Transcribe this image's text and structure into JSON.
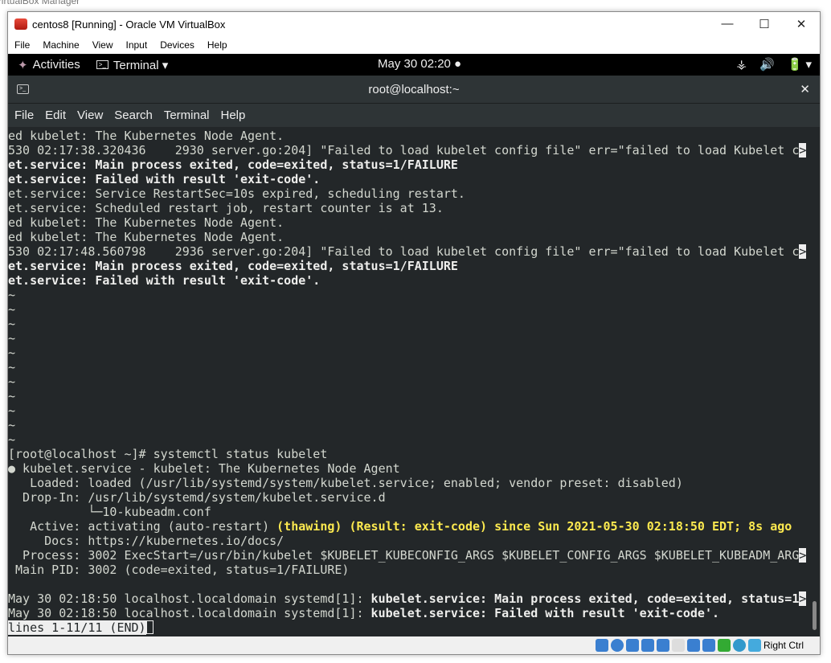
{
  "background": {
    "title": "VirtualBox Manager"
  },
  "window": {
    "title": "centos8 [Running] - Oracle VM VirtualBox",
    "controls": [
      "—",
      "☐",
      "✕"
    ]
  },
  "vbox_menu": [
    "File",
    "Machine",
    "View",
    "Input",
    "Devices",
    "Help"
  ],
  "gnome": {
    "activities": "Activities",
    "app": "Terminal ▾",
    "clock": "May 30  02:20 ●",
    "tray": [
      "⚶",
      "🔊",
      "🔋 ▾"
    ]
  },
  "terminal": {
    "title": "root@localhost:~",
    "close": "✕",
    "menu": [
      "File",
      "Edit",
      "View",
      "Search",
      "Terminal",
      "Help"
    ],
    "lines": [
      [
        [
          "n",
          "ed kubelet: The Kubernetes Node Agent."
        ]
      ],
      [
        [
          "n",
          "530 02:17:38.320436    2930 server.go:204] \"Failed to load kubelet config file\" err=\"failed to load Kubelet c"
        ],
        [
          "m",
          ">"
        ]
      ],
      [
        [
          "b",
          "et.service: Main process exited, code=exited, status=1/FAILURE"
        ]
      ],
      [
        [
          "b",
          "et.service: Failed with result 'exit-code'."
        ]
      ],
      [
        [
          "n",
          "et.service: Service RestartSec=10s expired, scheduling restart."
        ]
      ],
      [
        [
          "n",
          "et.service: Scheduled restart job, restart counter is at 13."
        ]
      ],
      [
        [
          "n",
          "ed kubelet: The Kubernetes Node Agent."
        ]
      ],
      [
        [
          "n",
          "ed kubelet: The Kubernetes Node Agent."
        ]
      ],
      [
        [
          "n",
          "530 02:17:48.560798    2936 server.go:204] \"Failed to load kubelet config file\" err=\"failed to load Kubelet c"
        ],
        [
          "m",
          ">"
        ]
      ],
      [
        [
          "b",
          "et.service: Main process exited, code=exited, status=1/FAILURE"
        ]
      ],
      [
        [
          "b",
          "et.service: Failed with result 'exit-code'."
        ]
      ],
      [
        [
          "n",
          "~"
        ]
      ],
      [
        [
          "n",
          "~"
        ]
      ],
      [
        [
          "n",
          "~"
        ]
      ],
      [
        [
          "n",
          "~"
        ]
      ],
      [
        [
          "n",
          "~"
        ]
      ],
      [
        [
          "n",
          "~"
        ]
      ],
      [
        [
          "n",
          "~"
        ]
      ],
      [
        [
          "n",
          "~"
        ]
      ],
      [
        [
          "n",
          "~"
        ]
      ],
      [
        [
          "n",
          "~"
        ]
      ],
      [
        [
          "n",
          "~"
        ]
      ],
      [
        [
          "n",
          "[root@localhost ~]# systemctl status kubelet"
        ]
      ],
      [
        [
          "n",
          "● kubelet.service - kubelet: The Kubernetes Node Agent"
        ]
      ],
      [
        [
          "n",
          "   Loaded: loaded (/usr/lib/systemd/system/kubelet.service; enabled; vendor preset: disabled)"
        ]
      ],
      [
        [
          "n",
          "  Drop-In: /usr/lib/systemd/system/kubelet.service.d"
        ]
      ],
      [
        [
          "n",
          "           └─10-kubeadm.conf"
        ]
      ],
      [
        [
          "n",
          "   Active: activating (auto-restart) "
        ],
        [
          "y",
          "(thawing) (Result: exit-code) since Sun 2021-05-30 02:18:50 EDT; 8s ago"
        ]
      ],
      [
        [
          "n",
          "     Docs: https://kubernetes.io/docs/"
        ]
      ],
      [
        [
          "n",
          "  Process: 3002 ExecStart=/usr/bin/kubelet $KUBELET_KUBECONFIG_ARGS $KUBELET_CONFIG_ARGS $KUBELET_KUBEADM_ARG"
        ],
        [
          "m",
          ">"
        ]
      ],
      [
        [
          "n",
          " Main PID: 3002 (code=exited, status=1/FAILURE)"
        ]
      ],
      [
        [
          "n",
          ""
        ]
      ],
      [
        [
          "n",
          "May 30 02:18:50 localhost.localdomain systemd[1]: "
        ],
        [
          "b",
          "kubelet.service: Main process exited, code=exited, status=1"
        ],
        [
          "m",
          ">"
        ]
      ],
      [
        [
          "n",
          "May 30 02:18:50 localhost.localdomain systemd[1]: "
        ],
        [
          "b",
          "kubelet.service: Failed with result 'exit-code'."
        ]
      ],
      [
        [
          "m",
          "lines 1-11/11 (END)"
        ],
        [
          "c",
          ""
        ]
      ]
    ]
  },
  "statusbar": {
    "host_key": "Right Ctrl"
  }
}
